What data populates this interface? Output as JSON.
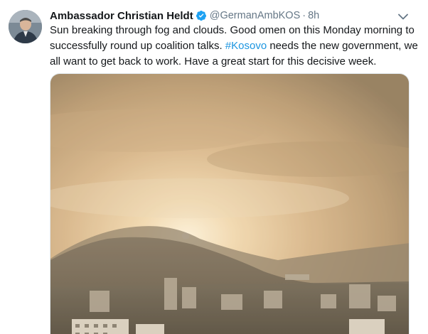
{
  "tweet": {
    "author_name": "Ambassador Christian Heldt",
    "verified_icon": "verified-badge-icon",
    "handle": "@GermanAmbKOS",
    "separator": "·",
    "time": "8h",
    "text_before": "Sun breaking through fog and clouds. Good omen on this Monday morning to successfully round up coalition talks. ",
    "hashtag": "#Kosovo",
    "text_after": " needs the new government, we all want to get back to work. Have a great start for this decisive week.",
    "menu_icon": "chevron-down-icon",
    "avatar_icon": "profile-avatar",
    "photo": "sunrise-fog-over-city-photo"
  },
  "colors": {
    "text": "#14171a",
    "secondary": "#657786",
    "link": "#1b95e0",
    "verified": "#1da1f2"
  }
}
